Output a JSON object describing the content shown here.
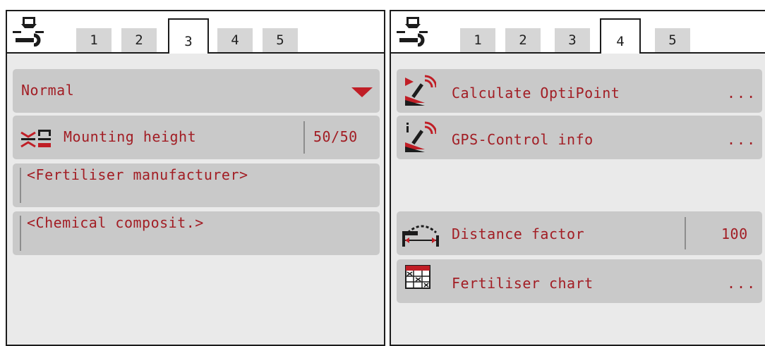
{
  "left_panel": {
    "tabs": [
      "1",
      "2",
      "3",
      "4",
      "5"
    ],
    "active_tab": "3",
    "mode_select": {
      "value": "Normal"
    },
    "mounting_height": {
      "label": "Mounting height",
      "value": "50/50"
    },
    "fertiliser_manufacturer": {
      "value": "<Fertiliser manufacturer>"
    },
    "chemical_composition": {
      "value": "<Chemical composit.>"
    }
  },
  "right_panel": {
    "tabs": [
      "1",
      "2",
      "3",
      "4",
      "5"
    ],
    "active_tab": "4",
    "calculate_optipoint": {
      "label": "Calculate OptiPoint",
      "more": "..."
    },
    "gps_control_info": {
      "label": "GPS-Control info",
      "more": "..."
    },
    "distance_factor": {
      "label": "Distance factor",
      "value": "100"
    },
    "fertiliser_chart": {
      "label": "Fertiliser chart",
      "more": "..."
    }
  },
  "colors": {
    "accent_text": "#a21d24",
    "row_bg": "#c9c9c9",
    "panel_bg": "#eaeaea",
    "tab_bg": "#d6d6d6"
  },
  "icons": [
    "machine-settings-icon",
    "dropdown-arrow-icon",
    "mounting-height-icon",
    "optipoint-calc-icon",
    "gps-info-icon",
    "distance-factor-icon",
    "fertiliser-chart-icon"
  ]
}
